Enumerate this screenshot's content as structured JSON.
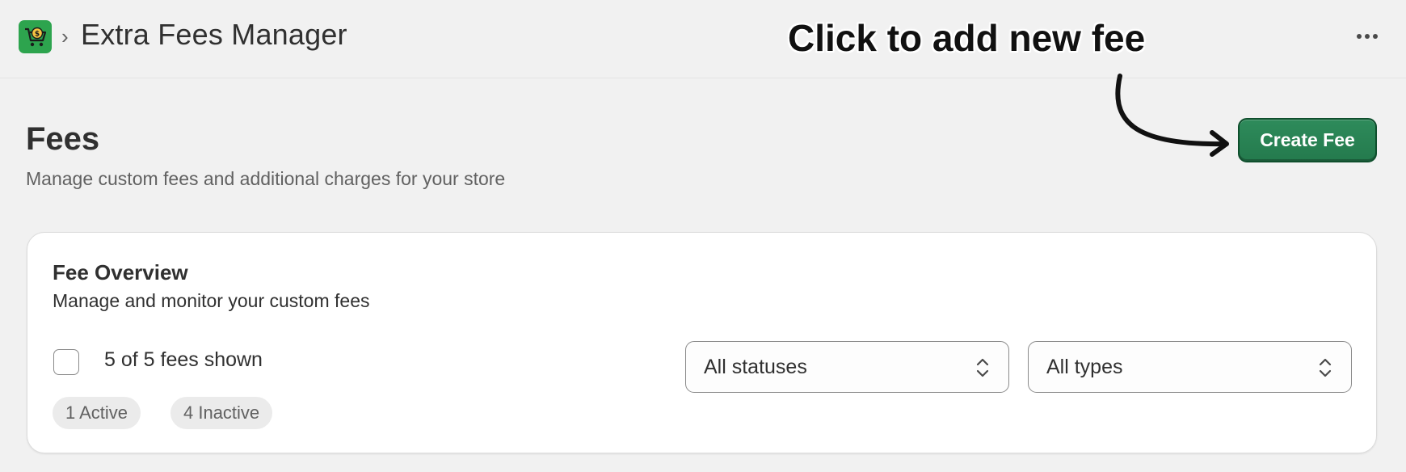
{
  "header": {
    "app_icon": "shopping-cart-dollar-icon",
    "breadcrumb_separator": "›",
    "app_title": "Extra Fees Manager",
    "more_icon": "more-horizontal-icon"
  },
  "annotation": {
    "text": "Click to add new fee",
    "arrow_icon": "curved-arrow-icon"
  },
  "page": {
    "title": "Fees",
    "subtitle": "Manage custom fees and additional charges for your store",
    "primary_action_label": "Create Fee"
  },
  "overview": {
    "title": "Fee Overview",
    "subtitle": "Manage and monitor your custom fees",
    "count_text": "5 of 5 fees shown",
    "badges": {
      "active": "1 Active",
      "inactive": "4 Inactive"
    },
    "status_filter": {
      "selected": "All statuses",
      "icon": "chevron-up-down-icon"
    },
    "type_filter": {
      "selected": "All types",
      "icon": "chevron-up-down-icon"
    }
  },
  "colors": {
    "primary_button": "#2e8b5b",
    "app_icon_bg": "#2da44e",
    "page_bg": "#f1f1f1"
  }
}
